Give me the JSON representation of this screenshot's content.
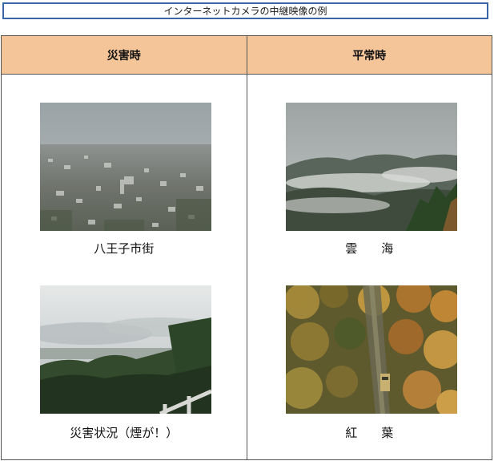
{
  "page_title": "インターネットカメラの中継映像の例",
  "table": {
    "columns": [
      {
        "header": "災害時"
      },
      {
        "header": "平常時"
      }
    ],
    "disaster": {
      "photo1_caption": "八王子市街",
      "photo1_image": "city-view-photo",
      "photo2_caption": "災害状況（煙が！）",
      "photo2_image": "smoke-forest-photo"
    },
    "normal": {
      "photo1_caption": "雲　　海",
      "photo1_image": "sea-of-clouds-photo",
      "photo2_caption": "紅　　葉",
      "photo2_image": "autumn-leaves-photo"
    }
  },
  "colors": {
    "header_bg": "#f5c59a",
    "title_border": "#3a66a8",
    "cell_border": "#555555"
  }
}
